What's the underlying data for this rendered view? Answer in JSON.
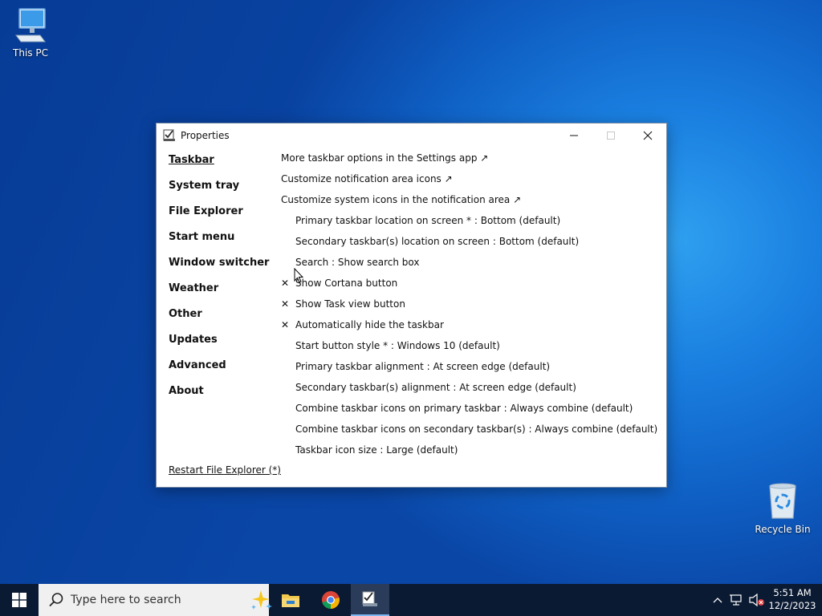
{
  "desktop": {
    "icons": [
      {
        "label": "This PC",
        "icon": "computer-icon"
      },
      {
        "label": "Recycle Bin",
        "icon": "recycle-bin-icon"
      }
    ]
  },
  "window": {
    "title": "Properties",
    "nav": [
      {
        "label": "Taskbar",
        "active": true
      },
      {
        "label": "System tray"
      },
      {
        "label": "File Explorer"
      },
      {
        "label": "Start menu"
      },
      {
        "label": "Window switcher"
      },
      {
        "label": "Weather"
      },
      {
        "label": "Other"
      },
      {
        "label": "Updates"
      },
      {
        "label": "Advanced"
      },
      {
        "label": "About"
      }
    ],
    "links": [
      "More taskbar options in the Settings app ↗",
      "Customize notification area icons ↗",
      "Customize system icons in the notification area ↗"
    ],
    "options": [
      {
        "text": "Primary taskbar location on screen * : Bottom (default)",
        "checked": false
      },
      {
        "text": "Secondary taskbar(s) location on screen : Bottom (default)",
        "checked": false
      },
      {
        "text": "Search : Show search box",
        "checked": false
      },
      {
        "text": "Show Cortana button",
        "checked": true
      },
      {
        "text": "Show Task view button",
        "checked": true
      },
      {
        "text": "Automatically hide the taskbar",
        "checked": true
      },
      {
        "text": "Start button style * : Windows 10 (default)",
        "checked": false
      },
      {
        "text": "Primary taskbar alignment : At screen edge (default)",
        "checked": false
      },
      {
        "text": "Secondary taskbar(s) alignment : At screen edge (default)",
        "checked": false
      },
      {
        "text": "Combine taskbar icons on primary taskbar : Always combine (default)",
        "checked": false
      },
      {
        "text": "Combine taskbar icons on secondary taskbar(s) : Always combine (default)",
        "checked": false
      },
      {
        "text": "Taskbar icon size : Large (default)",
        "checked": false
      }
    ],
    "check_mark": "✕",
    "restart_label": "Restart File Explorer (*)"
  },
  "taskbar": {
    "search_placeholder": "Type here to search",
    "apps": [
      "File Explorer",
      "Google Chrome",
      "Properties"
    ],
    "clock": {
      "time": "5:51 AM",
      "date": "12/2/2023"
    }
  }
}
